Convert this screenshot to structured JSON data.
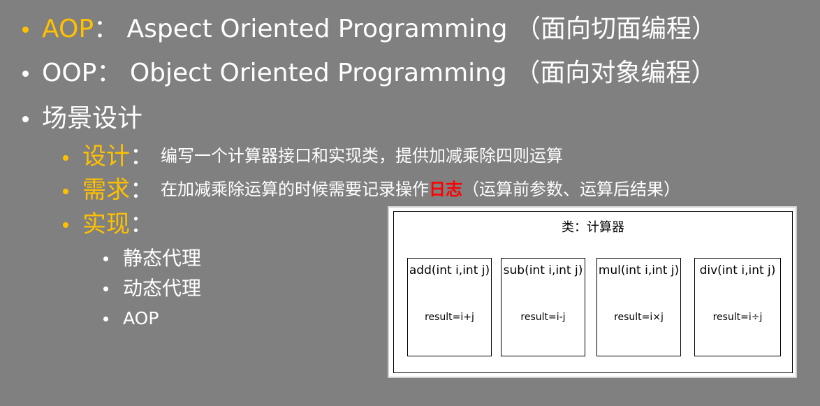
{
  "colors": {
    "background": "#808080",
    "text": "#ffffff",
    "accent": "#ffc000",
    "highlight": "#ff0000"
  },
  "bullets": {
    "aop": {
      "key": "AOP",
      "text": "： Aspect Oriented Programming （面向切面编程）"
    },
    "oop": {
      "text": "OOP： Object Oriented Programming （面向对象编程）"
    },
    "scene": {
      "text": "场景设计"
    }
  },
  "scene_items": {
    "design": {
      "key": "设计",
      "sep": "：",
      "text": "编写一个计算器接口和实现类，提供加减乘除四则运算"
    },
    "requirement": {
      "key": "需求",
      "sep": "：",
      "text_before": "在加减乘除运算的时候需要记录操作",
      "highlight": "日志",
      "text_after": "（运算前参数、运算后结果）"
    },
    "implementation": {
      "key": "实现",
      "sep": "："
    }
  },
  "impl_items": [
    "静态代理",
    "动态代理",
    "AOP"
  ],
  "diagram": {
    "title": "类：计算器",
    "methods": [
      {
        "signature": "add(int i,int j)",
        "result": "result=i+j"
      },
      {
        "signature": "sub(int i,int j)",
        "result": "result=i-j"
      },
      {
        "signature": "mul(int i,int j)",
        "result": "result=i×j"
      },
      {
        "signature": "div(int i,int j)",
        "result": "result=i÷j"
      }
    ]
  }
}
